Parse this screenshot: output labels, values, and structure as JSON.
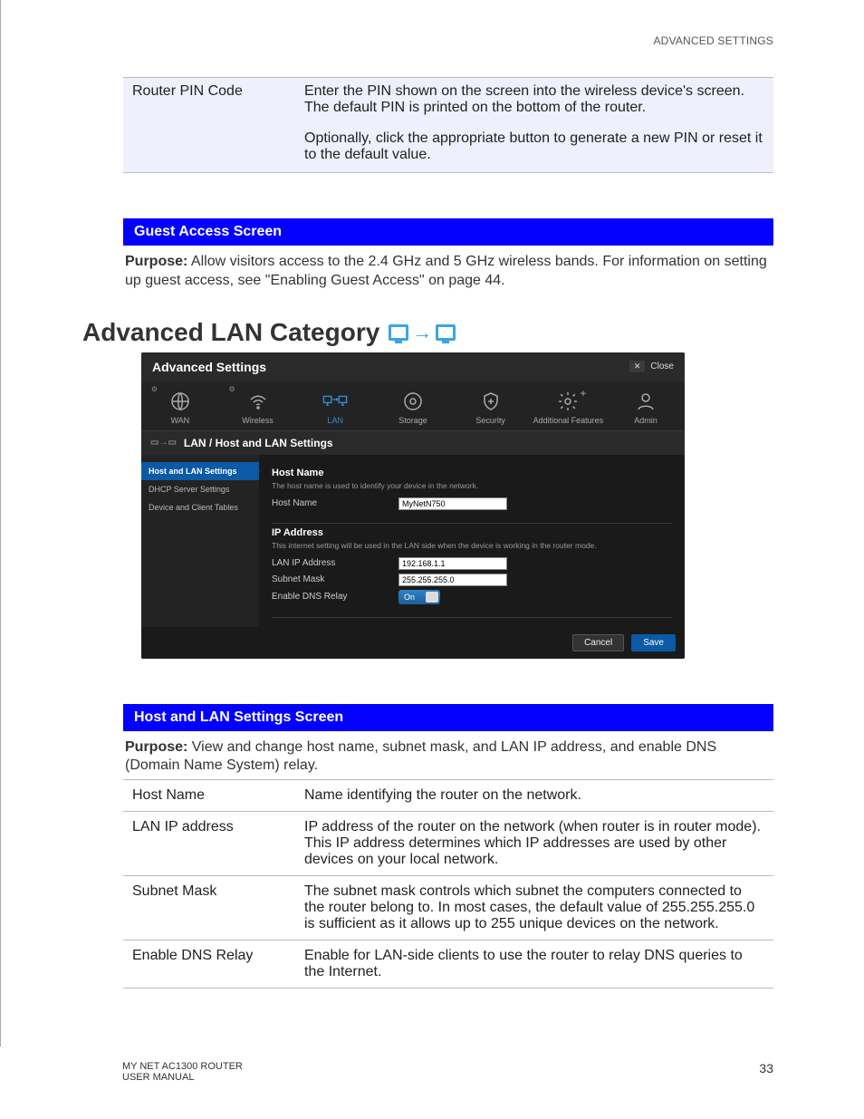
{
  "header": {
    "right": "ADVANCED SETTINGS"
  },
  "pin_row": {
    "label": "Router PIN Code",
    "p1": "Enter the PIN shown on the screen into the wireless device's screen. The default PIN is printed on the bottom of the router.",
    "p2": "Optionally, click the appropriate button to generate a new PIN or reset it to the default value."
  },
  "guest": {
    "title": "Guest Access Screen",
    "purpose_label": "Purpose:",
    "purpose": " Allow visitors access to the 2.4 GHz and 5 GHz wireless bands. For information on setting up guest access, see \"Enabling Guest Access\" on page 44."
  },
  "category": {
    "title": "Advanced LAN Category"
  },
  "shot": {
    "title": "Advanced Settings",
    "close": "Close",
    "tabs": [
      "WAN",
      "Wireless",
      "LAN",
      "Storage",
      "Security",
      "Additional Features",
      "Admin"
    ],
    "crumb": "LAN / Host and LAN Settings",
    "side": [
      "Host and LAN Settings",
      "DHCP Server Settings",
      "Device and Client Tables"
    ],
    "host": {
      "h": "Host Name",
      "hint": "The host name is used to identify your device in the network.",
      "label": "Host Name",
      "value": "MyNetN750"
    },
    "ip": {
      "h": "IP Address",
      "hint": "This internet setting will be used in the LAN side when the device is working in the router mode.",
      "lan_label": "LAN IP Address",
      "lan_value": "192.168.1.1",
      "mask_label": "Subnet Mask",
      "mask_value": "255.255.255.0",
      "dns_label": "Enable DNS Relay",
      "dns_value": "On"
    },
    "cancel": "Cancel",
    "save": "Save"
  },
  "host_screen": {
    "title": "Host and LAN Settings Screen",
    "purpose_label": "Purpose:",
    "purpose": " View and change host name, subnet mask, and LAN IP address, and enable DNS (Domain Name System) relay.",
    "rows": [
      {
        "l": "Host Name",
        "d": "Name identifying the router on the network."
      },
      {
        "l": "LAN IP address",
        "d": "IP address of the router on the network (when router is in router mode). This IP address determines which IP addresses are used by other devices on your local network."
      },
      {
        "l": "Subnet Mask",
        "d": "The subnet mask controls which subnet the computers connected to the router belong to. In most cases, the default value of 255.255.255.0 is sufficient as it allows up to 255 unique devices on the network."
      },
      {
        "l": "Enable DNS Relay",
        "d": "Enable for LAN-side clients to use the router to relay DNS queries to the Internet."
      }
    ]
  },
  "footer": {
    "l1": "MY NET AC1300 ROUTER",
    "l2": "USER MANUAL",
    "page": "33"
  }
}
